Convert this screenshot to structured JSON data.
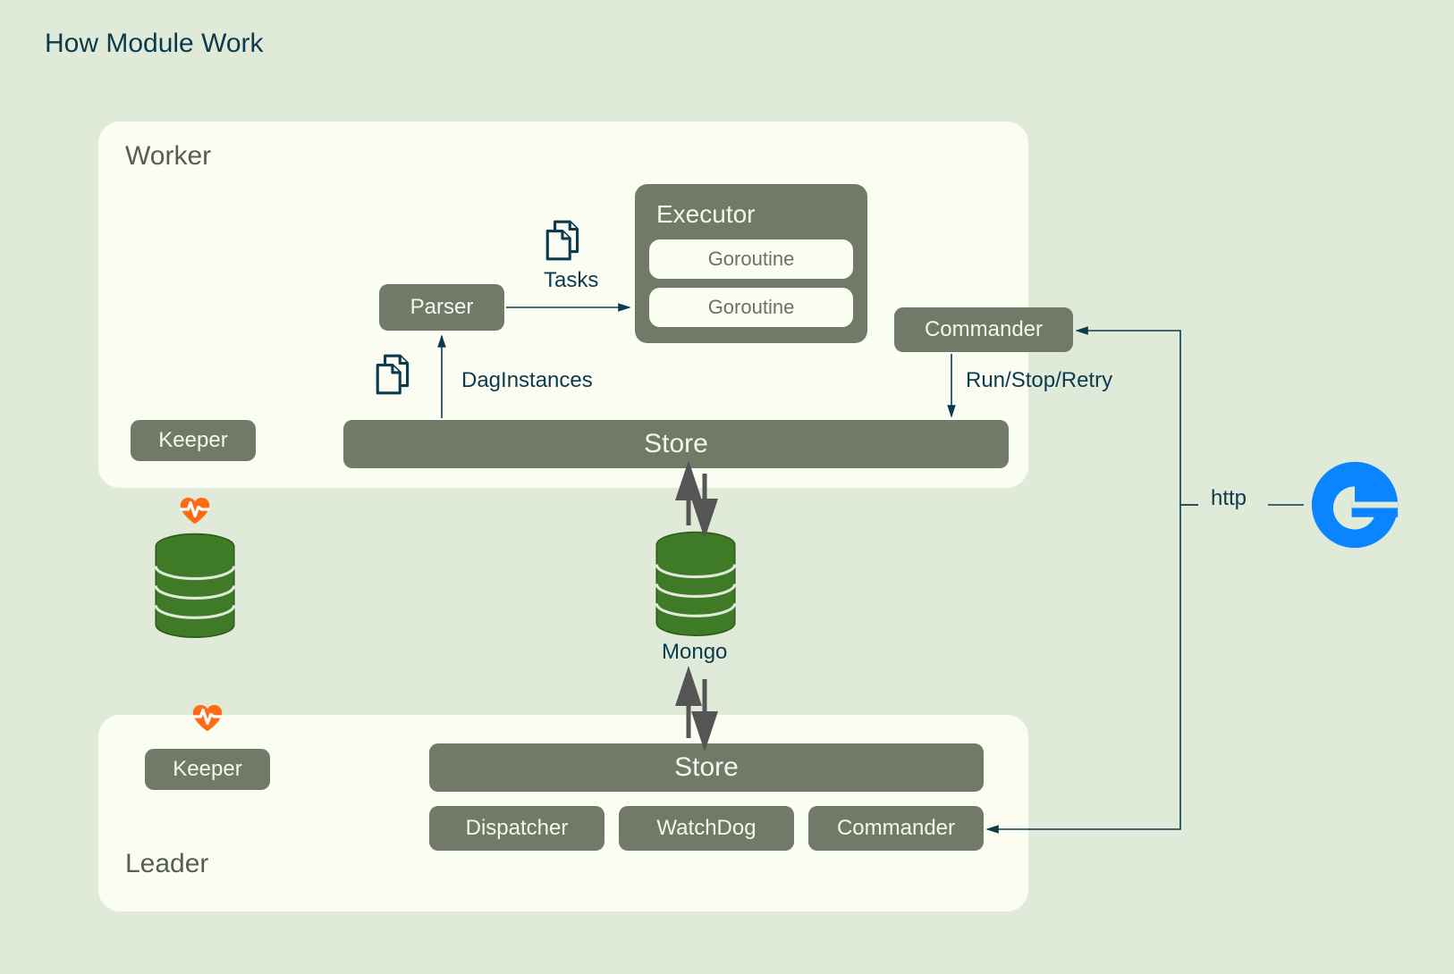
{
  "title": "How Module Work",
  "worker": {
    "label": "Worker",
    "keeper": "Keeper",
    "parser": "Parser",
    "store": "Store",
    "commander": "Commander",
    "executor": {
      "title": "Executor",
      "rows": [
        "Goroutine",
        "Goroutine"
      ]
    }
  },
  "leader": {
    "label": "Leader",
    "keeper": "Keeper",
    "store": "Store",
    "dispatcher": "Dispatcher",
    "watchdog": "WatchDog",
    "commander": "Commander"
  },
  "labels": {
    "tasks": "Tasks",
    "dagInstances": "DagInstances",
    "runStopRetry": "Run/Stop/Retry",
    "mongo": "Mongo",
    "http": "http"
  },
  "icons": {
    "heartbeat": "heartbeat-icon",
    "database": "database-icon",
    "documents": "documents-icon",
    "browser": "browser-edge-icon"
  },
  "colors": {
    "bg": "#dfead8",
    "panel": "#fbfcf2",
    "box": "#707a67",
    "text_dark": "#0c3b4e",
    "heart": "#ff6a13",
    "db": "#3f7a26",
    "edge": "#0a84ff"
  }
}
